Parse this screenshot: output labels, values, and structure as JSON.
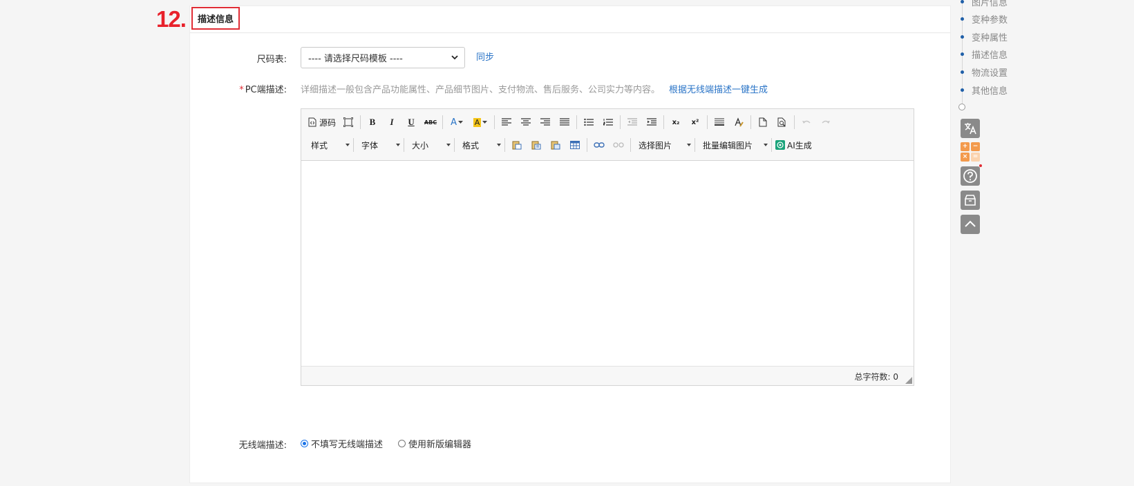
{
  "step_number": "12.",
  "section": {
    "title": "描述信息"
  },
  "size_chart": {
    "label": "尺码表:",
    "select_value": "---- 请选择尺码模板 ----",
    "sync_link": "同步"
  },
  "pc_description": {
    "required_mark": "*",
    "label": "PC端描述:",
    "hint": "详细描述一般包含产品功能属性、产品细节图片、支付物流、售后服务、公司实力等内容。",
    "generate_link": "根据无线端描述一键生成"
  },
  "editor": {
    "toolbar": {
      "source_label": "源码",
      "bold": "B",
      "italic": "I",
      "underline": "U",
      "strike": "ABC",
      "font_color": "A",
      "bg_color": "A",
      "subscript": "x₂",
      "superscript": "x²",
      "style_dropdown": "样式",
      "font_dropdown": "字体",
      "size_dropdown": "大小",
      "format_dropdown": "格式",
      "select_image_dropdown": "选择图片",
      "batch_edit_image_dropdown": "批量编辑图片",
      "ai_generate": "AI生成"
    },
    "content": "",
    "status": {
      "char_count_label": "总字符数:",
      "char_count_value": "0"
    }
  },
  "wireless_description": {
    "label": "无线端描述:",
    "options": [
      {
        "label": "不填写无线端描述",
        "checked": true
      },
      {
        "label": "使用新版编辑器",
        "checked": false
      }
    ]
  },
  "right_nav": {
    "items": [
      {
        "label": "图片信息"
      },
      {
        "label": "变种参数"
      },
      {
        "label": "变种属性"
      },
      {
        "label": "描述信息"
      },
      {
        "label": "物流设置"
      },
      {
        "label": "其他信息"
      }
    ],
    "tools": [
      "translate-icon",
      "calculator-icon",
      "help-icon",
      "archive-icon",
      "back-to-top-icon"
    ]
  },
  "colors": {
    "accent_red": "#e02d35",
    "link_blue": "#2a74c7",
    "nav_bullet": "#1f5fa8",
    "tool_gray": "#8a8a8a",
    "calc_orange": "#f39a4c"
  }
}
